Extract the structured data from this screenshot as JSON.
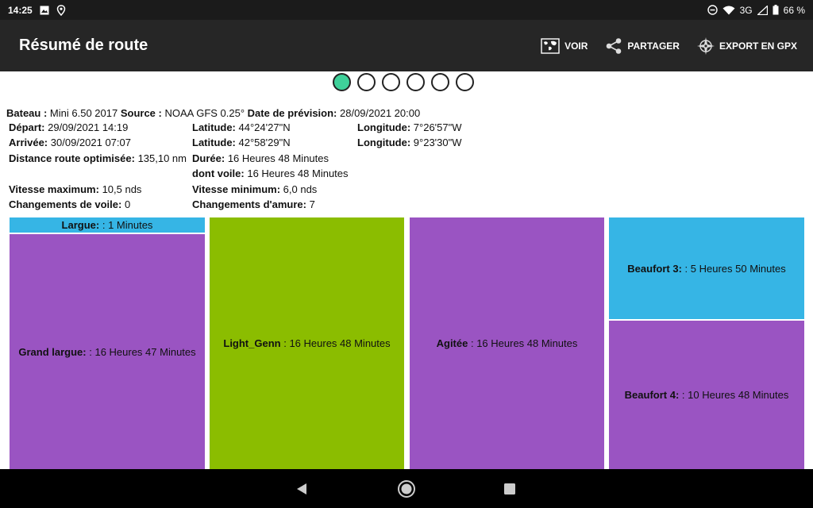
{
  "status_bar": {
    "time": "14:25",
    "network": "3G",
    "battery": "66 %"
  },
  "app_bar": {
    "title": "Résumé de route",
    "actions": [
      {
        "label": "VOIR",
        "icon": "map-view-icon"
      },
      {
        "label": "PARTAGER",
        "icon": "share-icon"
      },
      {
        "label": "EXPORT EN GPX",
        "icon": "compass-icon"
      }
    ]
  },
  "pager": {
    "count": 6,
    "active_index": 0
  },
  "summary": {
    "bateau_label": "Bateau :",
    "bateau_value": "Mini 6.50 2017",
    "source_label": "Source :",
    "source_value": "NOAA GFS 0.25°",
    "prevision_label": "Date de prévision:",
    "prevision_value": "28/09/2021 20:00",
    "depart_label": "Départ:",
    "depart_value": "29/09/2021 14:19",
    "lat1_label": "Latitude:",
    "lat1_value": "44°24'27\"N",
    "lon1_label": "Longitude:",
    "lon1_value": "7°26'57\"W",
    "arrivee_label": "Arrivée:",
    "arrivee_value": "30/09/2021 07:07",
    "lat2_label": "Latitude:",
    "lat2_value": "42°58'29\"N",
    "lon2_label": "Longitude:",
    "lon2_value": "9°23'30\"W",
    "distance_label": "Distance route optimisée:",
    "distance_value": "135,10 nm",
    "duree_label": "Durée:",
    "duree_value": "16 Heures 48 Minutes",
    "voile_label": "dont voile:",
    "voile_value": "16 Heures 48 Minutes",
    "vmax_label": "Vitesse maximum:",
    "vmax_value": "10,5 nds",
    "vmin_label": "Vitesse minimum:",
    "vmin_value": "6,0 nds",
    "chg_voile_label": "Changements de voile:",
    "chg_voile_value": "0",
    "chg_amure_label": "Changements d'amure:",
    "chg_amure_value": "7"
  },
  "treemap": {
    "colors": {
      "blue": "#36b5e5",
      "purple": "#9a54c2",
      "green": "#8bbd00"
    },
    "columns": [
      [
        {
          "label": "Largue:",
          "value": ": 1 Minutes",
          "color": "#36b5e5",
          "minutes": 1
        },
        {
          "label": "Grand largue:",
          "value": ": 16 Heures 47 Minutes",
          "color": "#9a54c2",
          "minutes": 1007
        }
      ],
      [
        {
          "label": "Light_Genn",
          "value": ": 16 Heures 48 Minutes",
          "color": "#8bbd00",
          "minutes": 1008
        }
      ],
      [
        {
          "label": "Agitée",
          "value": ": 16 Heures 48 Minutes",
          "color": "#9a54c2",
          "minutes": 1008
        }
      ],
      [
        {
          "label": "Beaufort 3:",
          "value": ": 5 Heures 50 Minutes",
          "color": "#36b5e5",
          "minutes": 350
        },
        {
          "label": "Beaufort 4:",
          "value": ": 10 Heures 48 Minutes",
          "color": "#9a54c2",
          "minutes": 648
        }
      ]
    ]
  }
}
